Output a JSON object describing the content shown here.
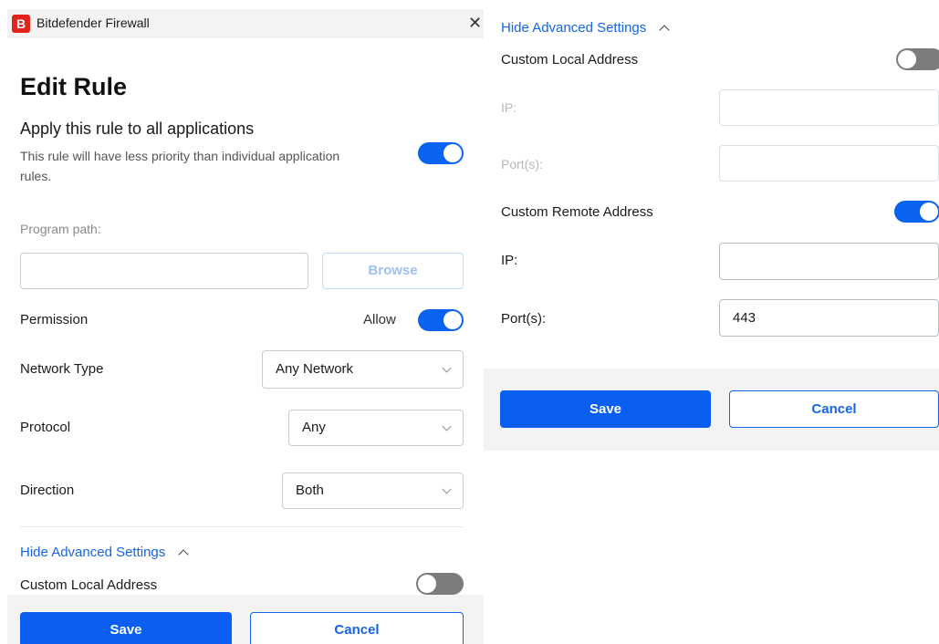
{
  "window": {
    "logo_letter": "B",
    "title": "Bitdefender Firewall",
    "close_glyph": "✕"
  },
  "edit_rule": {
    "heading": "Edit Rule",
    "apply_all_title": "Apply this rule to all applications",
    "apply_all_desc": "This rule will have less priority than individual application rules.",
    "apply_all_enabled": true,
    "program_path_label": "Program path:",
    "program_path_value": "",
    "browse_label": "Browse",
    "permission_label": "Permission",
    "permission_value": "Allow",
    "permission_enabled": true,
    "network_type_label": "Network Type",
    "network_type_value": "Any Network",
    "protocol_label": "Protocol",
    "protocol_value": "Any",
    "direction_label": "Direction",
    "direction_value": "Both",
    "advanced_toggle_label": "Hide Advanced Settings",
    "custom_local_label": "Custom Local Address",
    "custom_local_enabled": false
  },
  "advanced": {
    "toggle_label": "Hide Advanced Settings",
    "custom_local_label": "Custom Local Address",
    "custom_local_enabled": false,
    "local_ip_label": "IP:",
    "local_ip_value": "",
    "local_ports_label": "Port(s):",
    "local_ports_value": "",
    "custom_remote_label": "Custom Remote Address",
    "custom_remote_enabled": true,
    "remote_ip_label": "IP:",
    "remote_ip_value": "",
    "remote_ports_label": "Port(s):",
    "remote_ports_value": "443"
  },
  "buttons": {
    "save": "Save",
    "cancel": "Cancel"
  },
  "colors": {
    "accent": "#0a63f0",
    "link": "#1565e6",
    "brand_red": "#e2231a"
  }
}
